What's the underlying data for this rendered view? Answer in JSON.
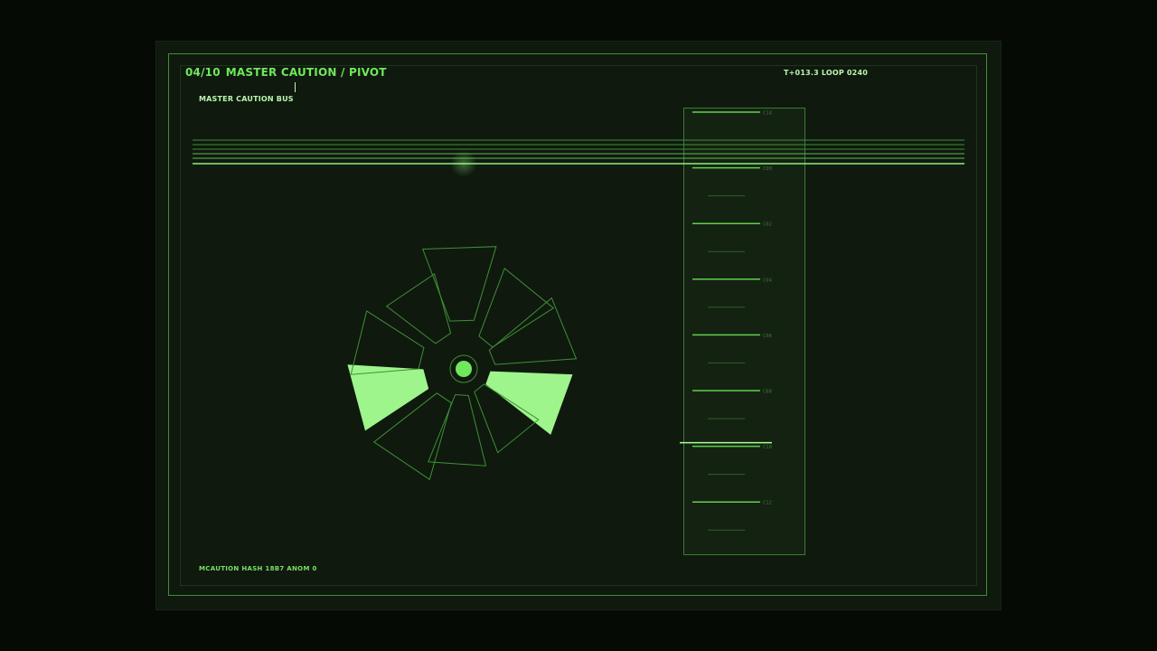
{
  "header": {
    "page_index": "04/10",
    "title": "MASTER CAUTION / PIVOT"
  },
  "telemetry": {
    "readout": "T+013.3  LOOP 0240"
  },
  "panel": {
    "label": "MASTER CAUTION BUS"
  },
  "footer": {
    "status": "MCAUTION  HASH 18B7  ANOM 0"
  },
  "bus": {
    "line_count": 6
  },
  "ladder": {
    "ticks": [
      "C14",
      "C00",
      "C02",
      "C04",
      "C06",
      "C08",
      "C10",
      "C12"
    ],
    "active_tick": "C10"
  },
  "rotor": {
    "segment_count": 10,
    "lit_segments": [
      3,
      7
    ]
  },
  "colors": {
    "accent": "#6fe85b",
    "lit": "#9ef58c",
    "dim": "#3d7a34",
    "background": "#0f190e"
  }
}
